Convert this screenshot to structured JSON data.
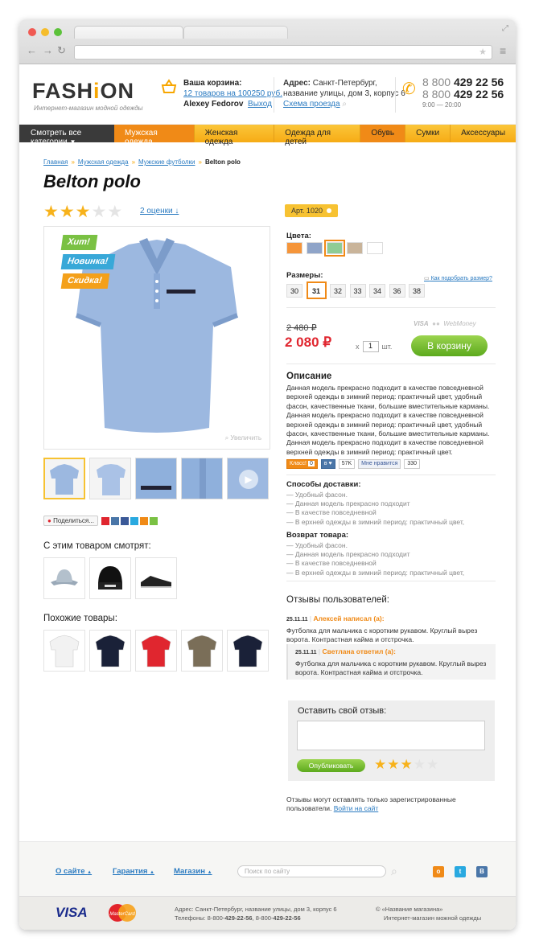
{
  "browser": {
    "url": ""
  },
  "header": {
    "logo": "FASHION",
    "logo_pre": "FASH",
    "logo_i": "i",
    "logo_post": "ON",
    "tagline": "Интернет-магазин модной одежды",
    "cart_title": "Ваша корзина:",
    "cart_summary": "12 товаров на 100250 руб.",
    "user_name": "Alexey Fedorov",
    "logout": "Выход",
    "address_label": "Адрес:",
    "address_text": " Санкт-Петербург,",
    "address_line2": "название улицы, дом 3, корпус 6",
    "map_link": "Схема проезда",
    "phone1_prefix": "8 800",
    "phone1_num": "429 22 56",
    "phone2_prefix": "8 800",
    "phone2_num": "429 22 56",
    "hours": "9:00 — 20:00"
  },
  "menu": {
    "all_categories": "Смотреть все категории",
    "items": [
      "Мужская одежда",
      "Женская одежда",
      "Одежда для детей",
      "Обувь",
      "Сумки",
      "Аксессуары"
    ]
  },
  "breadcrumbs": [
    "Главная",
    "Мужская одежда",
    "Мужские футболки",
    "Belton polo"
  ],
  "product": {
    "title": "Belton polo",
    "rating": 3,
    "rating_max": 5,
    "rating_link": "2 оценки ↓",
    "labels": [
      "Хит!",
      "Новинка!",
      "Скидка!"
    ],
    "zoom": "Увеличить",
    "article": "Арт. 1020",
    "colors_label": "Цвета:",
    "colors": [
      "#f5953a",
      "#8fa4c8",
      "#8fcc95",
      "#c9b49a",
      "#ffffff"
    ],
    "selected_color": 2,
    "sizes_label": "Размеры:",
    "sizes": [
      "30",
      "31",
      "32",
      "33",
      "34",
      "36",
      "38"
    ],
    "selected_size": 1,
    "size_help": "Как подобрать размер?",
    "old_price": "2 480 ₽",
    "price": "2 080 ₽",
    "qty_x": "х",
    "qty": "1",
    "qty_unit": "шт.",
    "buy": "В корзину",
    "payment": [
      "VISA",
      "MC",
      "WebMoney"
    ],
    "desc_title": "Описание",
    "description": "Данная модель прекрасно подходит в качестве повседневной верхней одежды в зимний период: практичный цвет, удобный фасон, качественные ткани, большие вместительные карманы. Данная модель прекрасно подходит в качестве повседневной верхней одежды в зимний период: практичный цвет, удобный фасон, качественные ткани, большие вместительные карманы. Данная модель прекрасно подходит в качестве повседневной верхней одежды в зимний период: практичный цвет.",
    "ok_label": "Класс!",
    "ok_count": "0",
    "vk_count": "57K",
    "fb_label": "Мне нравится",
    "fb_count": "330",
    "share_label": "Поделиться..."
  },
  "delivery": {
    "title": "Способы доставки:",
    "items": [
      "Удобный фасон.",
      "Данная модель прекрасно подходит",
      "В качестве повседневной",
      "В ерхней одежды в зимний период: практичный цвет,"
    ]
  },
  "returns": {
    "title": "Возврат товара:",
    "items": [
      "Удобный фасон.",
      "Данная модель прекрасно подходит",
      "В качестве повседневной",
      "В ерхней одежды в зимний период: практичный цвет,"
    ]
  },
  "also_watch": {
    "title": "С этим товаром смотрят:"
  },
  "similar": {
    "title": "Похожие товары:"
  },
  "reviews": {
    "title": "Отзывы пользователей:",
    "r1_date": "25.11.11",
    "r1_author": "Алексей написал (а):",
    "r1_text": "Футболка для мальчика с коротким рукавом. Круглый вырез ворота. Контрастная кайма и отстрочка.",
    "r2_date": "25.11.11",
    "r2_author": "Светлана ответил (а):",
    "r2_text": "Футболка для мальчика с коротким рукавом. Круглый вырез ворота. Контрастная кайма и отстрочка."
  },
  "review_form": {
    "title": "Оставить свой отзыв:",
    "publish": "Опубликовать",
    "rating": 3,
    "note": "Отзывы могут оставлять только зарегистрированные пользователи.",
    "login_link": "Войти на сайт"
  },
  "footer": {
    "links": [
      "О сайте",
      "Гарантия",
      "Магазин"
    ],
    "search_placeholder": "Поиск по сайту",
    "visa": "VISA",
    "mastercard": "MasterCard",
    "address": "Адрес: Санкт-Петербург, название улицы, дом 3, корпус 6",
    "phones_label": "Телефоны: 8-800-",
    "phone_a": "429-22-56",
    "phones_mid": ", 8-800-",
    "phone_b": "429-22-56",
    "copyright": "© «Название магазина»",
    "copyright2": "Интернет-магазин можной одежды"
  },
  "colors": {
    "accent": "#f7a600",
    "menu_active": "#f08a17",
    "link": "#2b7bc1",
    "price": "#e0262f",
    "buy": "#6cb52a"
  }
}
